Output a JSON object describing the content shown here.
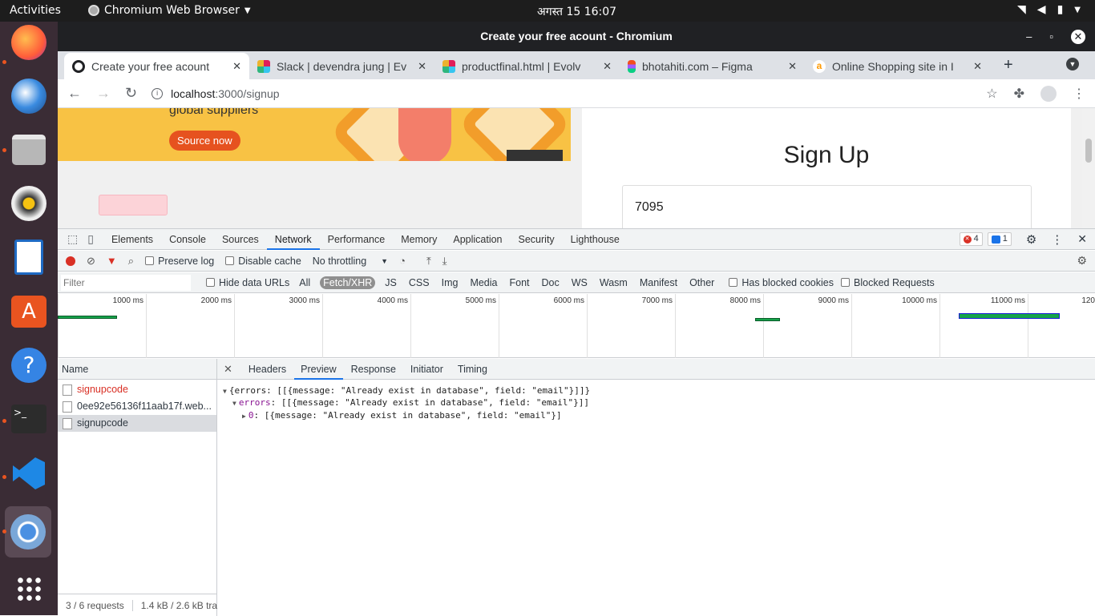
{
  "topbar": {
    "activities": "Activities",
    "app": "Chromium Web Browser",
    "clock": "अगस्त 15  16:07"
  },
  "window": {
    "title": "Create your free acount - Chromium"
  },
  "tabs": [
    {
      "label": "Create your free acount"
    },
    {
      "label": "Slack | devendra jung | Ev"
    },
    {
      "label": "productfinal.html | Evolv"
    },
    {
      "label": "bhotahiti.com – Figma"
    },
    {
      "label": "Online Shopping site in I"
    }
  ],
  "omnibox": {
    "host": "localhost",
    "path": ":3000/signup"
  },
  "page": {
    "banner_text": "global suppliers",
    "source_button": "Source now",
    "signup_title": "Sign Up",
    "field_value": "7095"
  },
  "devtools": {
    "tabs": [
      "Elements",
      "Console",
      "Sources",
      "Network",
      "Performance",
      "Memory",
      "Application",
      "Security",
      "Lighthouse"
    ],
    "errors_count": "4",
    "messages_count": "1",
    "preserve_log": "Preserve log",
    "disable_cache": "Disable cache",
    "throttling": "No throttling",
    "filter_placeholder": "Filter",
    "hide_data_urls": "Hide data URLs",
    "type_filters": [
      "All",
      "Fetch/XHR",
      "JS",
      "CSS",
      "Img",
      "Media",
      "Font",
      "Doc",
      "WS",
      "Wasm",
      "Manifest",
      "Other"
    ],
    "has_blocked_cookies": "Has blocked cookies",
    "blocked_requests": "Blocked Requests",
    "timeline_ticks": [
      "1000 ms",
      "2000 ms",
      "3000 ms",
      "4000 ms",
      "5000 ms",
      "6000 ms",
      "7000 ms",
      "8000 ms",
      "9000 ms",
      "10000 ms",
      "11000 ms",
      "120"
    ],
    "name_header": "Name",
    "requests": [
      {
        "name": "signupcode",
        "error": true
      },
      {
        "name": "0ee92e56136f11aab17f.web...",
        "error": false
      },
      {
        "name": "signupcode",
        "error": false
      }
    ],
    "status_requests": "3 / 6 requests",
    "status_size": "1.4 kB / 2.6 kB tra",
    "detail_tabs": [
      "Headers",
      "Preview",
      "Response",
      "Initiator",
      "Timing"
    ],
    "preview": {
      "line1": "{errors: [[{message: \"Already exist in database\", field: \"email\"}]]}",
      "line2_key": "errors",
      "line2_val": "[[{message: \"Already exist in database\", field: \"email\"}]]",
      "line3_key": "0",
      "line3_val": "[{message: \"Already exist in database\", field: \"email\"}]"
    }
  },
  "colors": {
    "accent": "#1a73e8",
    "error": "#d93025",
    "ubuntu_orange": "#e95420"
  }
}
